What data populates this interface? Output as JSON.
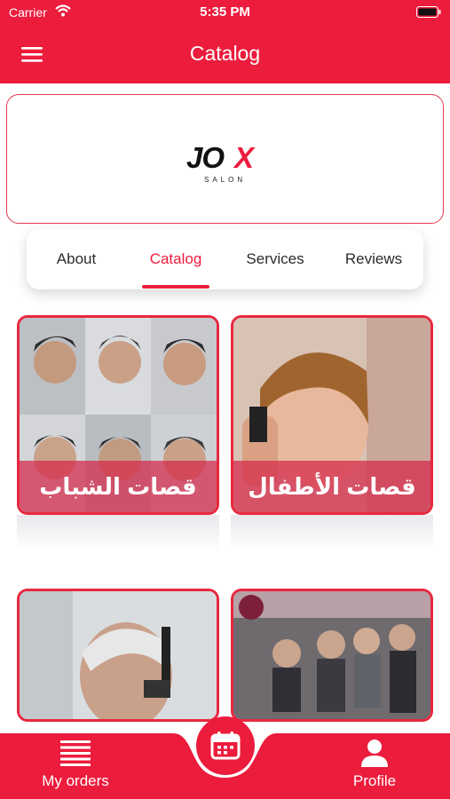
{
  "status_bar": {
    "carrier": "Carrier",
    "time": "5:35 PM"
  },
  "header": {
    "title": "Catalog"
  },
  "logo": {
    "brand": "JOX",
    "sub": "SALON"
  },
  "tabs": [
    {
      "label": "About",
      "active": false
    },
    {
      "label": "Catalog",
      "active": true
    },
    {
      "label": "Services",
      "active": false
    },
    {
      "label": "Reviews",
      "active": false
    }
  ],
  "catalog": [
    {
      "label": "قصات الشباب"
    },
    {
      "label": "قصات الأطفال"
    },
    {
      "label": ""
    },
    {
      "label": ""
    }
  ],
  "bottom_nav": {
    "orders_label": "My orders",
    "profile_label": "Profile"
  },
  "colors": {
    "accent": "#ec1c3d",
    "card_overlay": "#d6284a"
  }
}
